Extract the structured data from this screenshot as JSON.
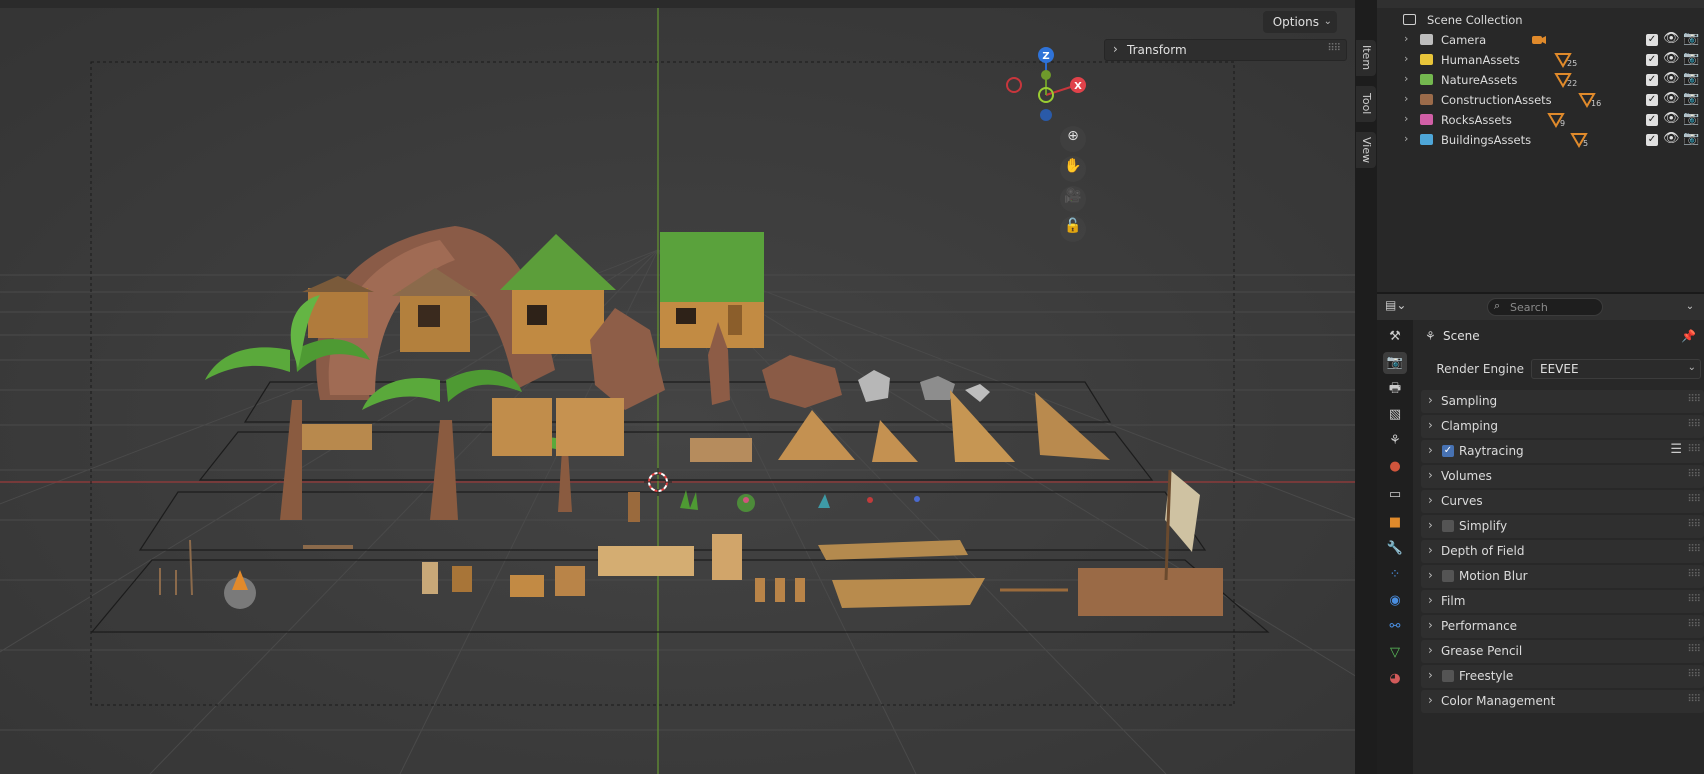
{
  "viewport": {
    "options_label": "Options",
    "transform_label": "Transform",
    "sidebar_tabs": [
      "Item",
      "Tool",
      "View"
    ],
    "gizmo": {
      "z": "Z",
      "x": "X"
    }
  },
  "outliner": {
    "scene_collection": "Scene Collection",
    "items": [
      {
        "name": "Camera",
        "color": "#bdbdbd",
        "badge": "camera-data",
        "count": ""
      },
      {
        "name": "HumanAssets",
        "color": "#e8c53a",
        "badge": "mesh",
        "count": "25"
      },
      {
        "name": "NatureAssets",
        "color": "#74b84f",
        "badge": "mesh",
        "count": "22"
      },
      {
        "name": "ConstructionAssets",
        "color": "#9b6b4a",
        "badge": "mesh",
        "count": "16"
      },
      {
        "name": "RocksAssets",
        "color": "#d15fa6",
        "badge": "mesh",
        "count": "9"
      },
      {
        "name": "BuildingsAssets",
        "color": "#4ea6d8",
        "badge": "mesh",
        "count": "5"
      }
    ]
  },
  "properties": {
    "search_placeholder": "Search",
    "scene_label": "Scene",
    "render_engine_label": "Render Engine",
    "render_engine_value": "EEVEE",
    "panels": [
      {
        "label": "Sampling",
        "checkbox": null
      },
      {
        "label": "Clamping",
        "checkbox": null
      },
      {
        "label": "Raytracing",
        "checkbox": true
      },
      {
        "label": "Volumes",
        "checkbox": null
      },
      {
        "label": "Curves",
        "checkbox": null
      },
      {
        "label": "Simplify",
        "checkbox": false
      },
      {
        "label": "Depth of Field",
        "checkbox": null
      },
      {
        "label": "Motion Blur",
        "checkbox": false
      },
      {
        "label": "Film",
        "checkbox": null
      },
      {
        "label": "Performance",
        "checkbox": null
      },
      {
        "label": "Grease Pencil",
        "checkbox": null
      },
      {
        "label": "Freestyle",
        "checkbox": false
      },
      {
        "label": "Color Management",
        "checkbox": null
      }
    ]
  }
}
